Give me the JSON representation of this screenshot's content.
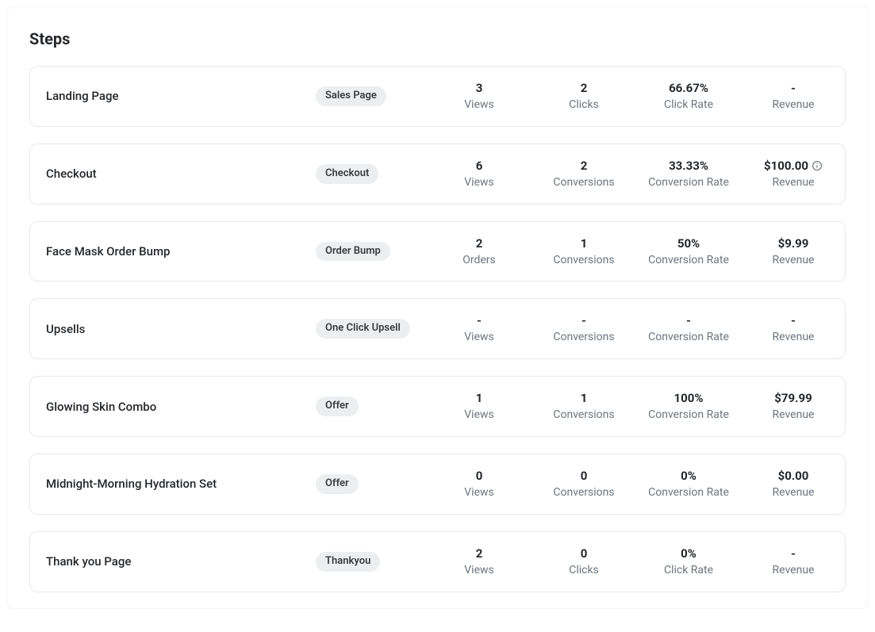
{
  "title": "Steps",
  "steps": [
    {
      "name": "Landing Page",
      "badge": "Sales Page",
      "metrics": [
        {
          "value": "3",
          "label": "Views",
          "info": false
        },
        {
          "value": "2",
          "label": "Clicks",
          "info": false
        },
        {
          "value": "66.67%",
          "label": "Click Rate",
          "info": false
        },
        {
          "value": "-",
          "label": "Revenue",
          "info": false
        }
      ]
    },
    {
      "name": "Checkout",
      "badge": "Checkout",
      "metrics": [
        {
          "value": "6",
          "label": "Views",
          "info": false
        },
        {
          "value": "2",
          "label": "Conversions",
          "info": false
        },
        {
          "value": "33.33%",
          "label": "Conversion Rate",
          "info": false
        },
        {
          "value": "$100.00",
          "label": "Revenue",
          "info": true
        }
      ]
    },
    {
      "name": "Face Mask Order Bump",
      "badge": "Order Bump",
      "metrics": [
        {
          "value": "2",
          "label": "Orders",
          "info": false
        },
        {
          "value": "1",
          "label": "Conversions",
          "info": false
        },
        {
          "value": "50%",
          "label": "Conversion Rate",
          "info": false
        },
        {
          "value": "$9.99",
          "label": "Revenue",
          "info": false
        }
      ]
    },
    {
      "name": "Upsells",
      "badge": "One Click Upsell",
      "metrics": [
        {
          "value": "-",
          "label": "Views",
          "info": false
        },
        {
          "value": "-",
          "label": "Conversions",
          "info": false
        },
        {
          "value": "-",
          "label": "Conversion Rate",
          "info": false
        },
        {
          "value": "-",
          "label": "Revenue",
          "info": false
        }
      ]
    },
    {
      "name": "Glowing Skin Combo",
      "badge": "Offer",
      "metrics": [
        {
          "value": "1",
          "label": "Views",
          "info": false
        },
        {
          "value": "1",
          "label": "Conversions",
          "info": false
        },
        {
          "value": "100%",
          "label": "Conversion Rate",
          "info": false
        },
        {
          "value": "$79.99",
          "label": "Revenue",
          "info": false
        }
      ]
    },
    {
      "name": "Midnight-Morning Hydration Set",
      "badge": "Offer",
      "metrics": [
        {
          "value": "0",
          "label": "Views",
          "info": false
        },
        {
          "value": "0",
          "label": "Conversions",
          "info": false
        },
        {
          "value": "0%",
          "label": "Conversion Rate",
          "info": false
        },
        {
          "value": "$0.00",
          "label": "Revenue",
          "info": false
        }
      ]
    },
    {
      "name": "Thank you Page",
      "badge": "Thankyou",
      "metrics": [
        {
          "value": "2",
          "label": "Views",
          "info": false
        },
        {
          "value": "0",
          "label": "Clicks",
          "info": false
        },
        {
          "value": "0%",
          "label": "Click Rate",
          "info": false
        },
        {
          "value": "-",
          "label": "Revenue",
          "info": false
        }
      ]
    }
  ]
}
